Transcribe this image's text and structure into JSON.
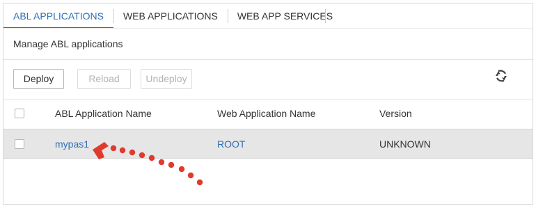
{
  "tabs": [
    {
      "label": "ABL APPLICATIONS",
      "active": true
    },
    {
      "label": "WEB APPLICATIONS",
      "active": false
    },
    {
      "label": "WEB APP SERVICES",
      "active": false
    }
  ],
  "subtitle": "Manage ABL applications",
  "toolbar": {
    "deploy_label": "Deploy",
    "reload_label": "Reload",
    "undeploy_label": "Undeploy",
    "refresh_icon": "refresh-arrows-icon"
  },
  "table": {
    "columns": [
      "ABL Application Name",
      "Web Application Name",
      "Version"
    ],
    "rows": [
      {
        "abl_app": "mypas1",
        "web_app": "ROOT",
        "version": "UNKNOWN"
      }
    ]
  },
  "colors": {
    "accent": "#2f6fb6",
    "annotation_arrow": "#e03a2e",
    "selected_row": "#e6e6e6"
  }
}
